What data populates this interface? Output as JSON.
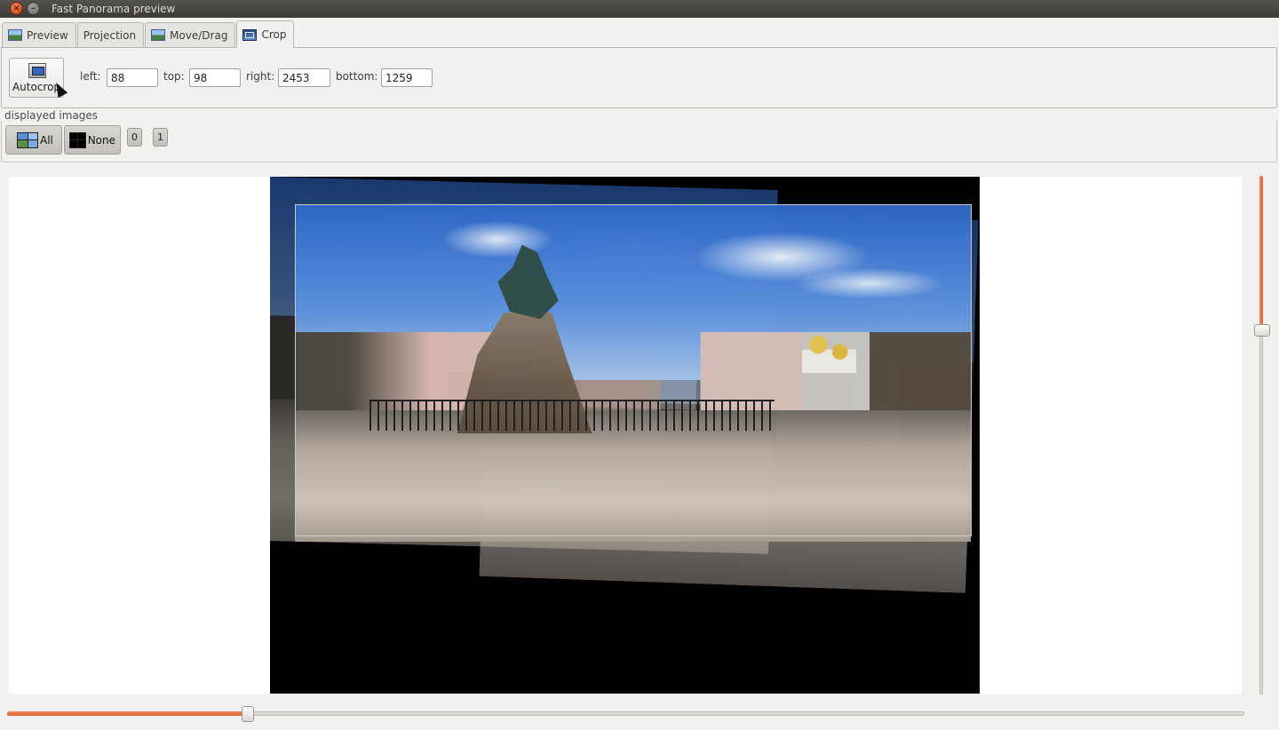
{
  "window": {
    "title": "Fast Panorama preview"
  },
  "tabs": [
    {
      "label": "Preview"
    },
    {
      "label": "Projection"
    },
    {
      "label": "Move/Drag"
    },
    {
      "label": "Crop"
    }
  ],
  "active_tab": "Crop",
  "crop": {
    "autocrop_label": "Autocrop",
    "left_label": "left:",
    "left_value": "88",
    "top_label": "top:",
    "top_value": "98",
    "right_label": "right:",
    "right_value": "2453",
    "bottom_label": "bottom:",
    "bottom_value": "1259"
  },
  "displayed_images": {
    "title": "displayed images",
    "all_label": "All",
    "none_label": "None",
    "image_buttons": [
      "0",
      "1"
    ]
  },
  "colors": {
    "accent": "#e0642e",
    "titlebar": "#3c3b37",
    "preview_background": "#000000"
  },
  "sliders": {
    "vertical_level": 0.3,
    "horizontal_level": 0.195
  }
}
